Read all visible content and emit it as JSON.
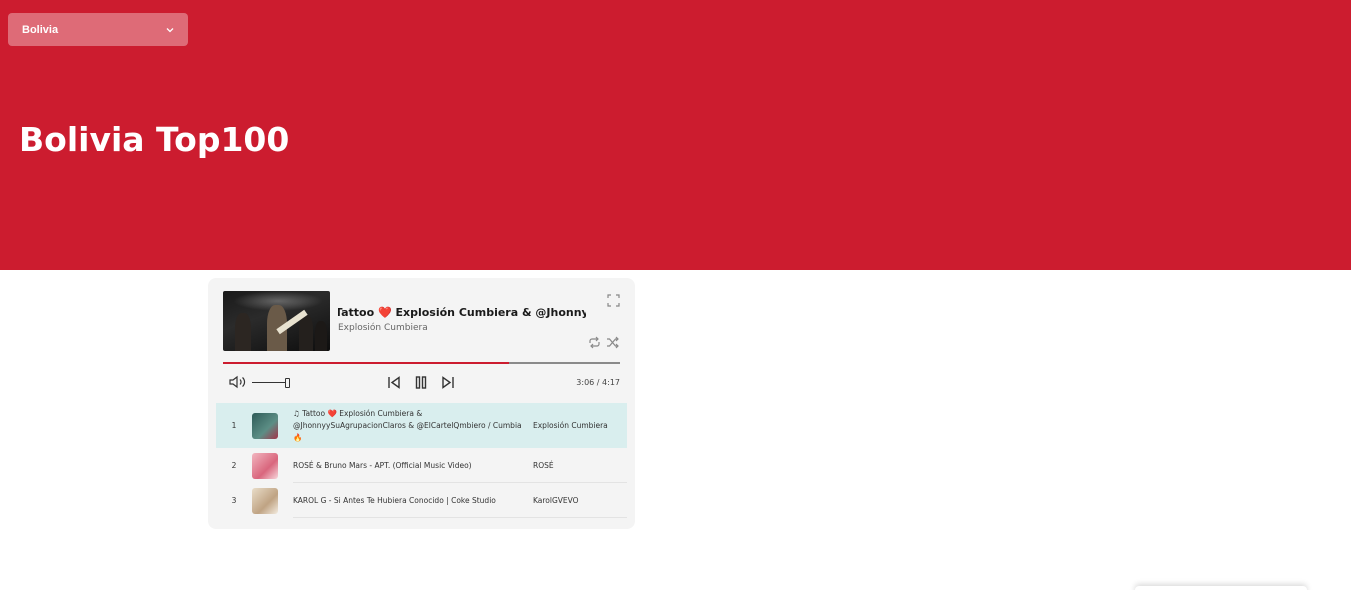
{
  "header": {
    "country_select": "Bolivia",
    "title": "Bolivia Top100",
    "accent_color": "#cc1c2f"
  },
  "player": {
    "now_playing": {
      "title": "Tattoo ❤️ Explosión Cumbiera & @JhonnyySu...",
      "artist": "Explosión Cumbiera"
    },
    "progress_fraction": 0.72,
    "time": "3:06 / 4:17",
    "volume_fraction": 1.0,
    "icons": {
      "fullscreen": "fullscreen-icon",
      "repeat": "repeat-icon",
      "shuffle": "shuffle-icon",
      "volume": "volume-icon",
      "prev": "skip-previous-icon",
      "pause": "pause-icon",
      "next": "skip-next-icon"
    }
  },
  "tracks": [
    {
      "num": "1",
      "title": "♫ Tattoo ❤️ Explosión Cumbiera & @JhonnyySuAgrupacionClaros & @ElCartelQmbiero / Cumbia 🔥",
      "artist": "Explosión Cumbiera",
      "active": true,
      "thumb_color": "#3f6e6a"
    },
    {
      "num": "2",
      "title": "ROSÉ & Bruno Mars - APT. (Official Music Video)",
      "artist": "ROSÉ",
      "active": false,
      "thumb_color": "#e79aa6"
    },
    {
      "num": "3",
      "title": "KAROL G - Si Antes Te Hubiera Conocido | Coke Studio",
      "artist": "KarolGVEVO",
      "active": false,
      "thumb_color": "#cdb79c"
    }
  ]
}
